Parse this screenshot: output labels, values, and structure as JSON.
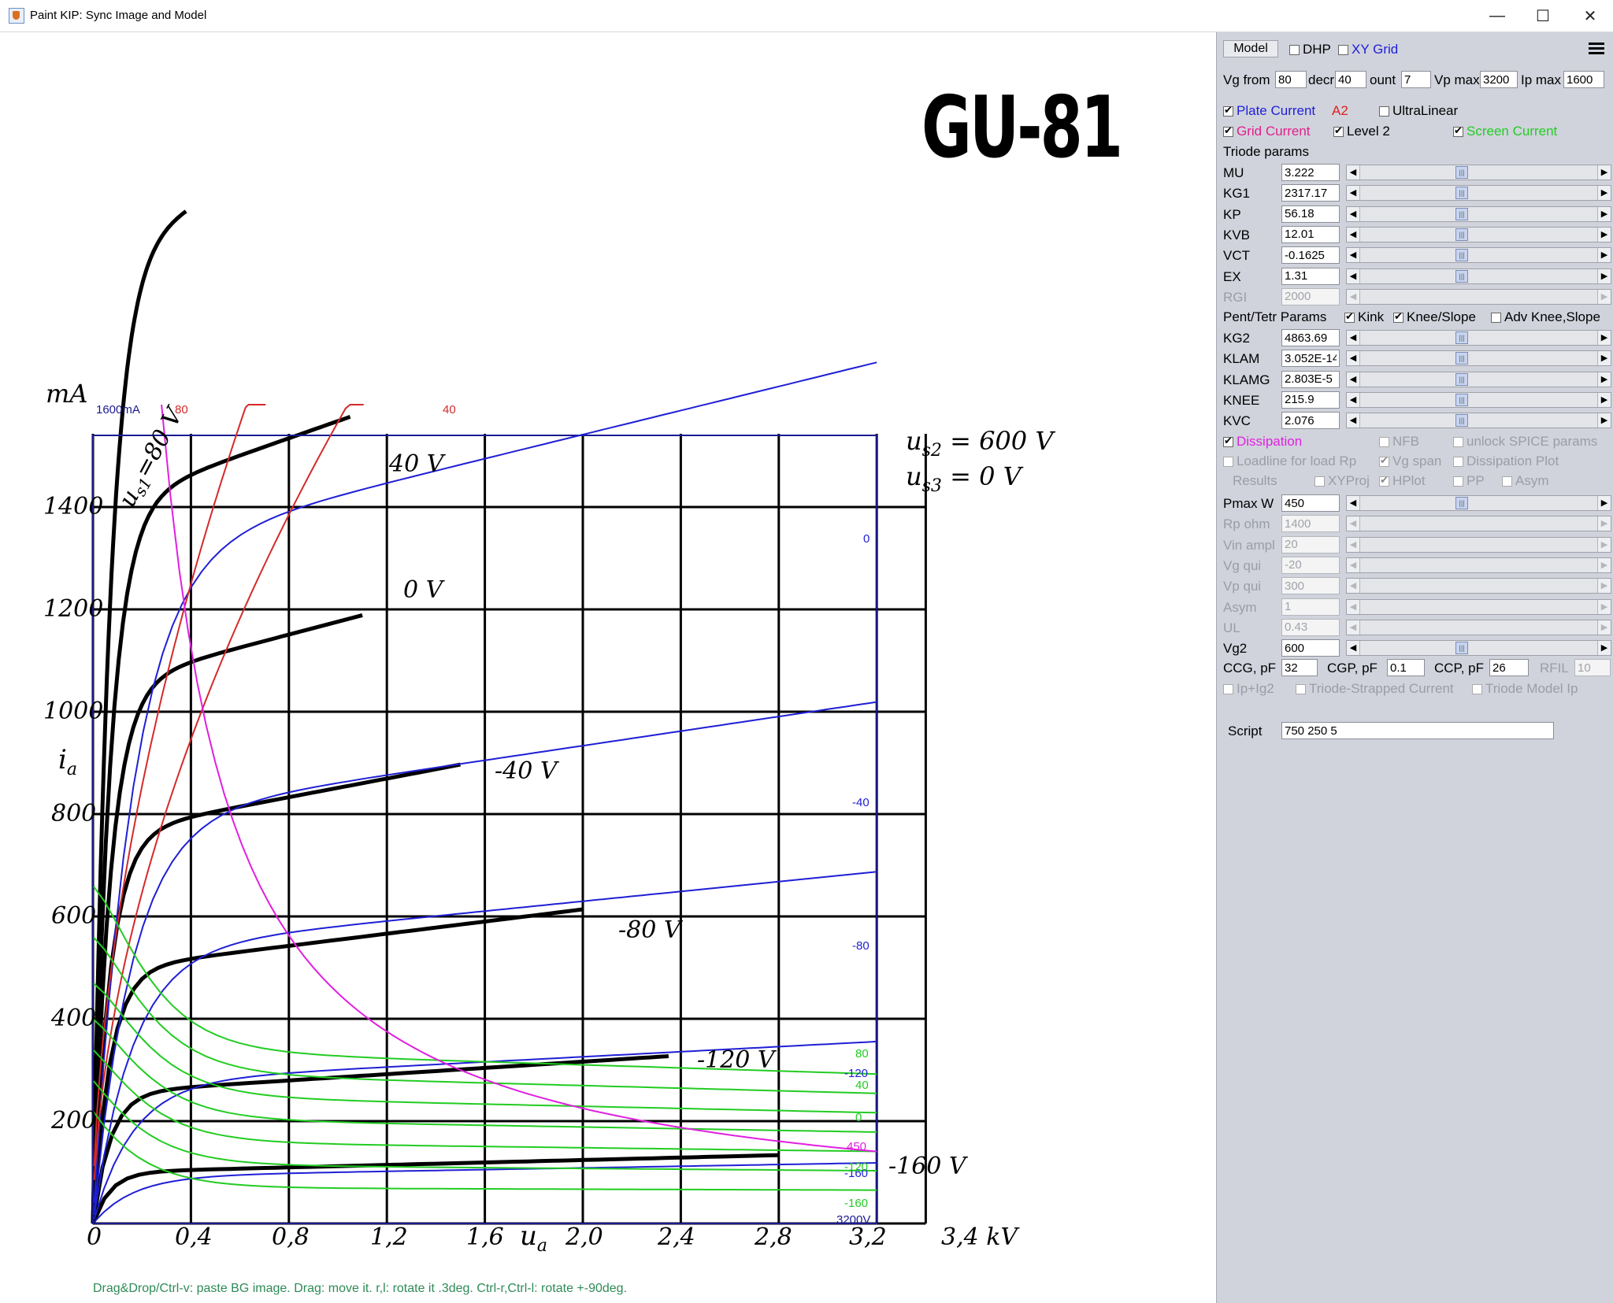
{
  "window": {
    "title": "Paint KIP: Sync Image and Model",
    "minimize": "—",
    "maximize": "☐",
    "close": "✕"
  },
  "canvas": {
    "tube_title": "GU-81",
    "hint": "Drag&Drop/Ctrl-v: paste BG image. Drag: move it. r,l: rotate it .3deg. Ctrl-r,Ctrl-l: rotate +-90deg.",
    "scan": {
      "y_unit": "mA",
      "y_ticks": [
        "1400",
        "1200",
        "1000",
        "800",
        "600",
        "400",
        "200"
      ],
      "y_symbol": "i",
      "y_symbol_sub": "a",
      "x_ticks": [
        "0",
        "0,4",
        "0,8",
        "1,2",
        "1,6",
        "2,0",
        "2,4",
        "2,8",
        "3,2",
        "3,4 kV"
      ],
      "x_symbol": "u",
      "x_symbol_sub": "a",
      "conditions": [
        "u",
        "s2",
        " = 600 V",
        "u",
        "s3",
        " = 0 V"
      ],
      "curve_labels": [
        "u",
        "s1",
        "=80 V",
        "40 V",
        "0 V",
        "-40 V",
        "-80 V",
        "-120 V",
        "-160 V"
      ]
    },
    "overlay": {
      "max_label": "1600mA",
      "red_labels": [
        "80",
        "40"
      ],
      "blue_labels": [
        "0",
        "-40",
        "-80",
        "-120",
        "-160"
      ],
      "green_labels": [
        "80",
        "40",
        "0",
        "-120",
        "-160"
      ],
      "magenta_label": "450",
      "vmax_label": "3200V"
    },
    "colors": {
      "plate": "#1f1fd6",
      "grid": "#d42a2a",
      "screen": "#22cc22",
      "dissipation": "#e020e0",
      "frame": "#1a1a90"
    }
  },
  "panel": {
    "model_tab": "Model",
    "dhp": {
      "label": "DHP",
      "checked": false
    },
    "xy_grid": {
      "label": "XY Grid",
      "checked": false
    },
    "vg_from_label": "Vg from",
    "vg_from": "80",
    "decr_label": "decr",
    "decr": "40",
    "count_label": "ount",
    "count": "7",
    "vp_max_label": "Vp max",
    "vp_max": "3200",
    "ip_max_label": "Ip max",
    "ip_max": "1600",
    "plate_current": "Plate Current",
    "a2": "A2",
    "ultralinear": "UltraLinear",
    "grid_current": "Grid Current",
    "level2": "Level 2",
    "screen_current": "Screen Current",
    "triode_params": "Triode params",
    "params": [
      {
        "name": "MU",
        "value": "3.222"
      },
      {
        "name": "KG1",
        "value": "2317.17"
      },
      {
        "name": "KP",
        "value": "56.18"
      },
      {
        "name": "KVB",
        "value": "12.01"
      },
      {
        "name": "VCT",
        "value": "-0.1625"
      },
      {
        "name": "EX",
        "value": "1.31"
      },
      {
        "name": "RGI",
        "value": "2000"
      }
    ],
    "pent_params": "Pent/Tetr Params",
    "kink": "Kink",
    "knee_slope": "Knee/Slope",
    "adv_knee": "Adv Knee,Slope",
    "pent_list": [
      {
        "name": "KG2",
        "value": "4863.69"
      },
      {
        "name": "KLAM",
        "value": "3.052E-14"
      },
      {
        "name": "KLAMG",
        "value": "2.803E-5"
      },
      {
        "name": "KNEE",
        "value": "215.9"
      },
      {
        "name": "KVC",
        "value": "2.076"
      }
    ],
    "dissipation": "Dissipation",
    "nfb": "NFB",
    "unlock_spice": "unlock SPICE params",
    "loadline": "Loadline for load Rp",
    "vg_span": "Vg span",
    "dissipation_plot": "Dissipation Plot",
    "results": "Results",
    "xyproj": "XYProj",
    "hplot": "HPlot",
    "pp": "PP",
    "asym_cb": "Asym",
    "op_list": [
      {
        "name": "Pmax W",
        "value": "450"
      },
      {
        "name": "Rp ohm",
        "value": "1400"
      },
      {
        "name": "Vin ampl",
        "value": "20"
      },
      {
        "name": "Vg qui",
        "value": "-20"
      },
      {
        "name": "Vp qui",
        "value": "300"
      },
      {
        "name": "Asym",
        "value": "1"
      },
      {
        "name": "UL",
        "value": "0.43"
      },
      {
        "name": "Vg2",
        "value": "600"
      }
    ],
    "ccg_label": "CCG, pF",
    "ccg": "32",
    "cgp_label": "CGP, pF",
    "cgp": "0.1",
    "ccp_label": "CCP, pF",
    "ccp": "26",
    "rfil_label": "RFIL",
    "rfil": "10",
    "ip_ig2": "Ip+Ig2",
    "triode_strapped": "Triode-Strapped Current",
    "triode_model_ip": "Triode Model Ip",
    "script_label": "Script",
    "script": "750 250 5"
  }
}
